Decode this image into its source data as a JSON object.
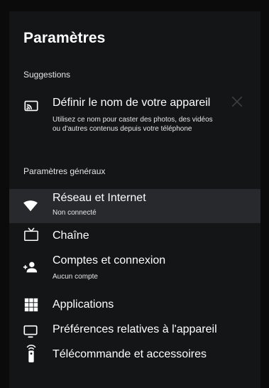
{
  "header": {
    "title": "Paramètres"
  },
  "suggestions": {
    "label": "Suggestions",
    "item": {
      "title": "Définir le nom de votre appareil",
      "description": "Utilisez ce nom pour caster des photos, des vidéos ou d'autres contenus depuis votre téléphone",
      "icon": "cast-icon",
      "dismiss_icon": "close-icon"
    }
  },
  "general": {
    "label": "Paramètres généraux",
    "items": [
      {
        "title": "Réseau et Internet",
        "subtitle": "Non connecté",
        "icon": "wifi-icon",
        "selected": true
      },
      {
        "title": "Chaîne",
        "subtitle": "",
        "icon": "tv-icon"
      },
      {
        "title": "Comptes et connexion",
        "subtitle": "Aucun compte",
        "icon": "add-account-icon"
      },
      {
        "title": "Applications",
        "subtitle": "",
        "icon": "apps-grid-icon"
      },
      {
        "title": "Préférences relatives à l'appareil",
        "subtitle": "",
        "icon": "monitor-icon"
      },
      {
        "title": "Télécommande et accessoires",
        "subtitle": "",
        "icon": "remote-icon"
      }
    ]
  },
  "colors": {
    "background": "#0b0b0c",
    "panel": "#141516",
    "selected_row": "#27292c",
    "text": "#ffffff"
  }
}
